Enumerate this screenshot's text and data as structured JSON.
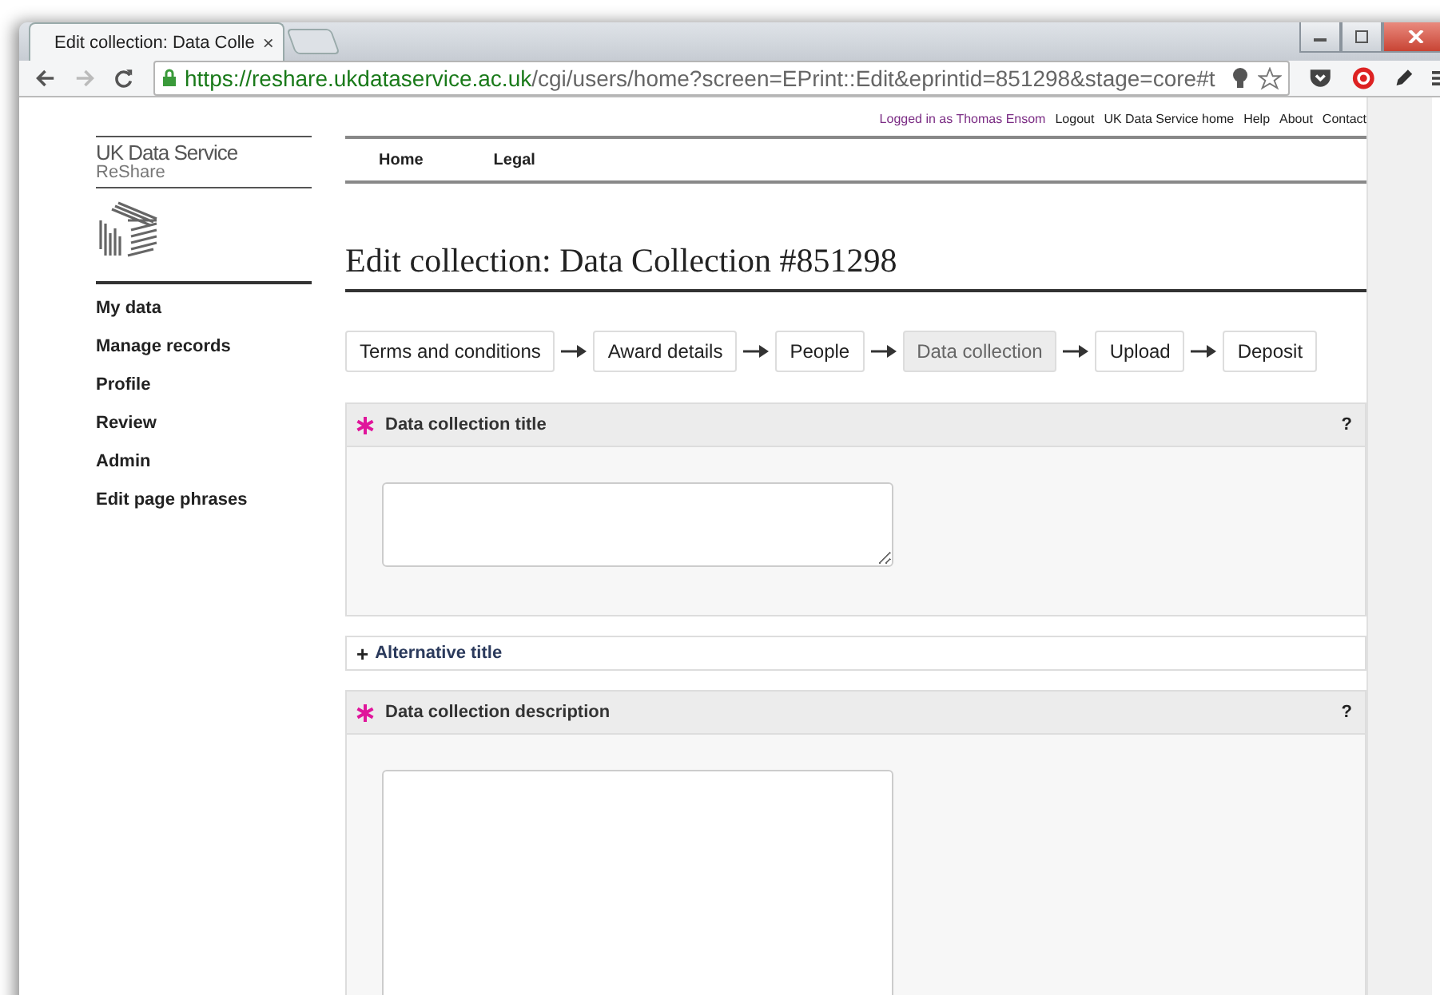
{
  "browser": {
    "tab_title": "Edit collection: Data Colle",
    "tab_close": "×",
    "url_host": "https://reshare.ukdataservice.ac.uk",
    "url_path": "/cgi/users/home?screen=EPrint::Edit&eprintid=851298&stage=core#t"
  },
  "top_links": [
    {
      "label": "Logged in as Thomas Ensom",
      "kind": "status"
    },
    {
      "label": "Logout",
      "kind": "link"
    },
    {
      "label": "UK Data Service home",
      "kind": "link"
    },
    {
      "label": "Help",
      "kind": "link"
    },
    {
      "label": "About",
      "kind": "link"
    },
    {
      "label": "Contact",
      "kind": "link"
    }
  ],
  "logo": {
    "name": "UK Data Service",
    "product": "ReShare"
  },
  "nav": [
    {
      "label": "Home"
    },
    {
      "label": "Legal"
    }
  ],
  "sidebar": {
    "items": [
      {
        "label": "My data"
      },
      {
        "label": "Manage records"
      },
      {
        "label": "Profile"
      },
      {
        "label": "Review"
      },
      {
        "label": "Admin"
      },
      {
        "label": "Edit page phrases"
      }
    ]
  },
  "heading": "Edit collection: Data Collection #851298",
  "steps": [
    {
      "label": "Terms and conditions",
      "selected": false
    },
    {
      "label": "Award details",
      "selected": false
    },
    {
      "label": "People",
      "selected": false
    },
    {
      "label": "Data collection",
      "selected": true
    },
    {
      "label": "Upload",
      "selected": false
    },
    {
      "label": "Deposit",
      "selected": false
    }
  ],
  "sections": [
    {
      "kind": "field",
      "required": true,
      "title": "Data collection title",
      "help": "?"
    },
    {
      "kind": "collapsed",
      "toggle": "+",
      "title": "Alternative title"
    },
    {
      "kind": "field",
      "required": true,
      "title": "Data collection description",
      "help": "?"
    }
  ]
}
